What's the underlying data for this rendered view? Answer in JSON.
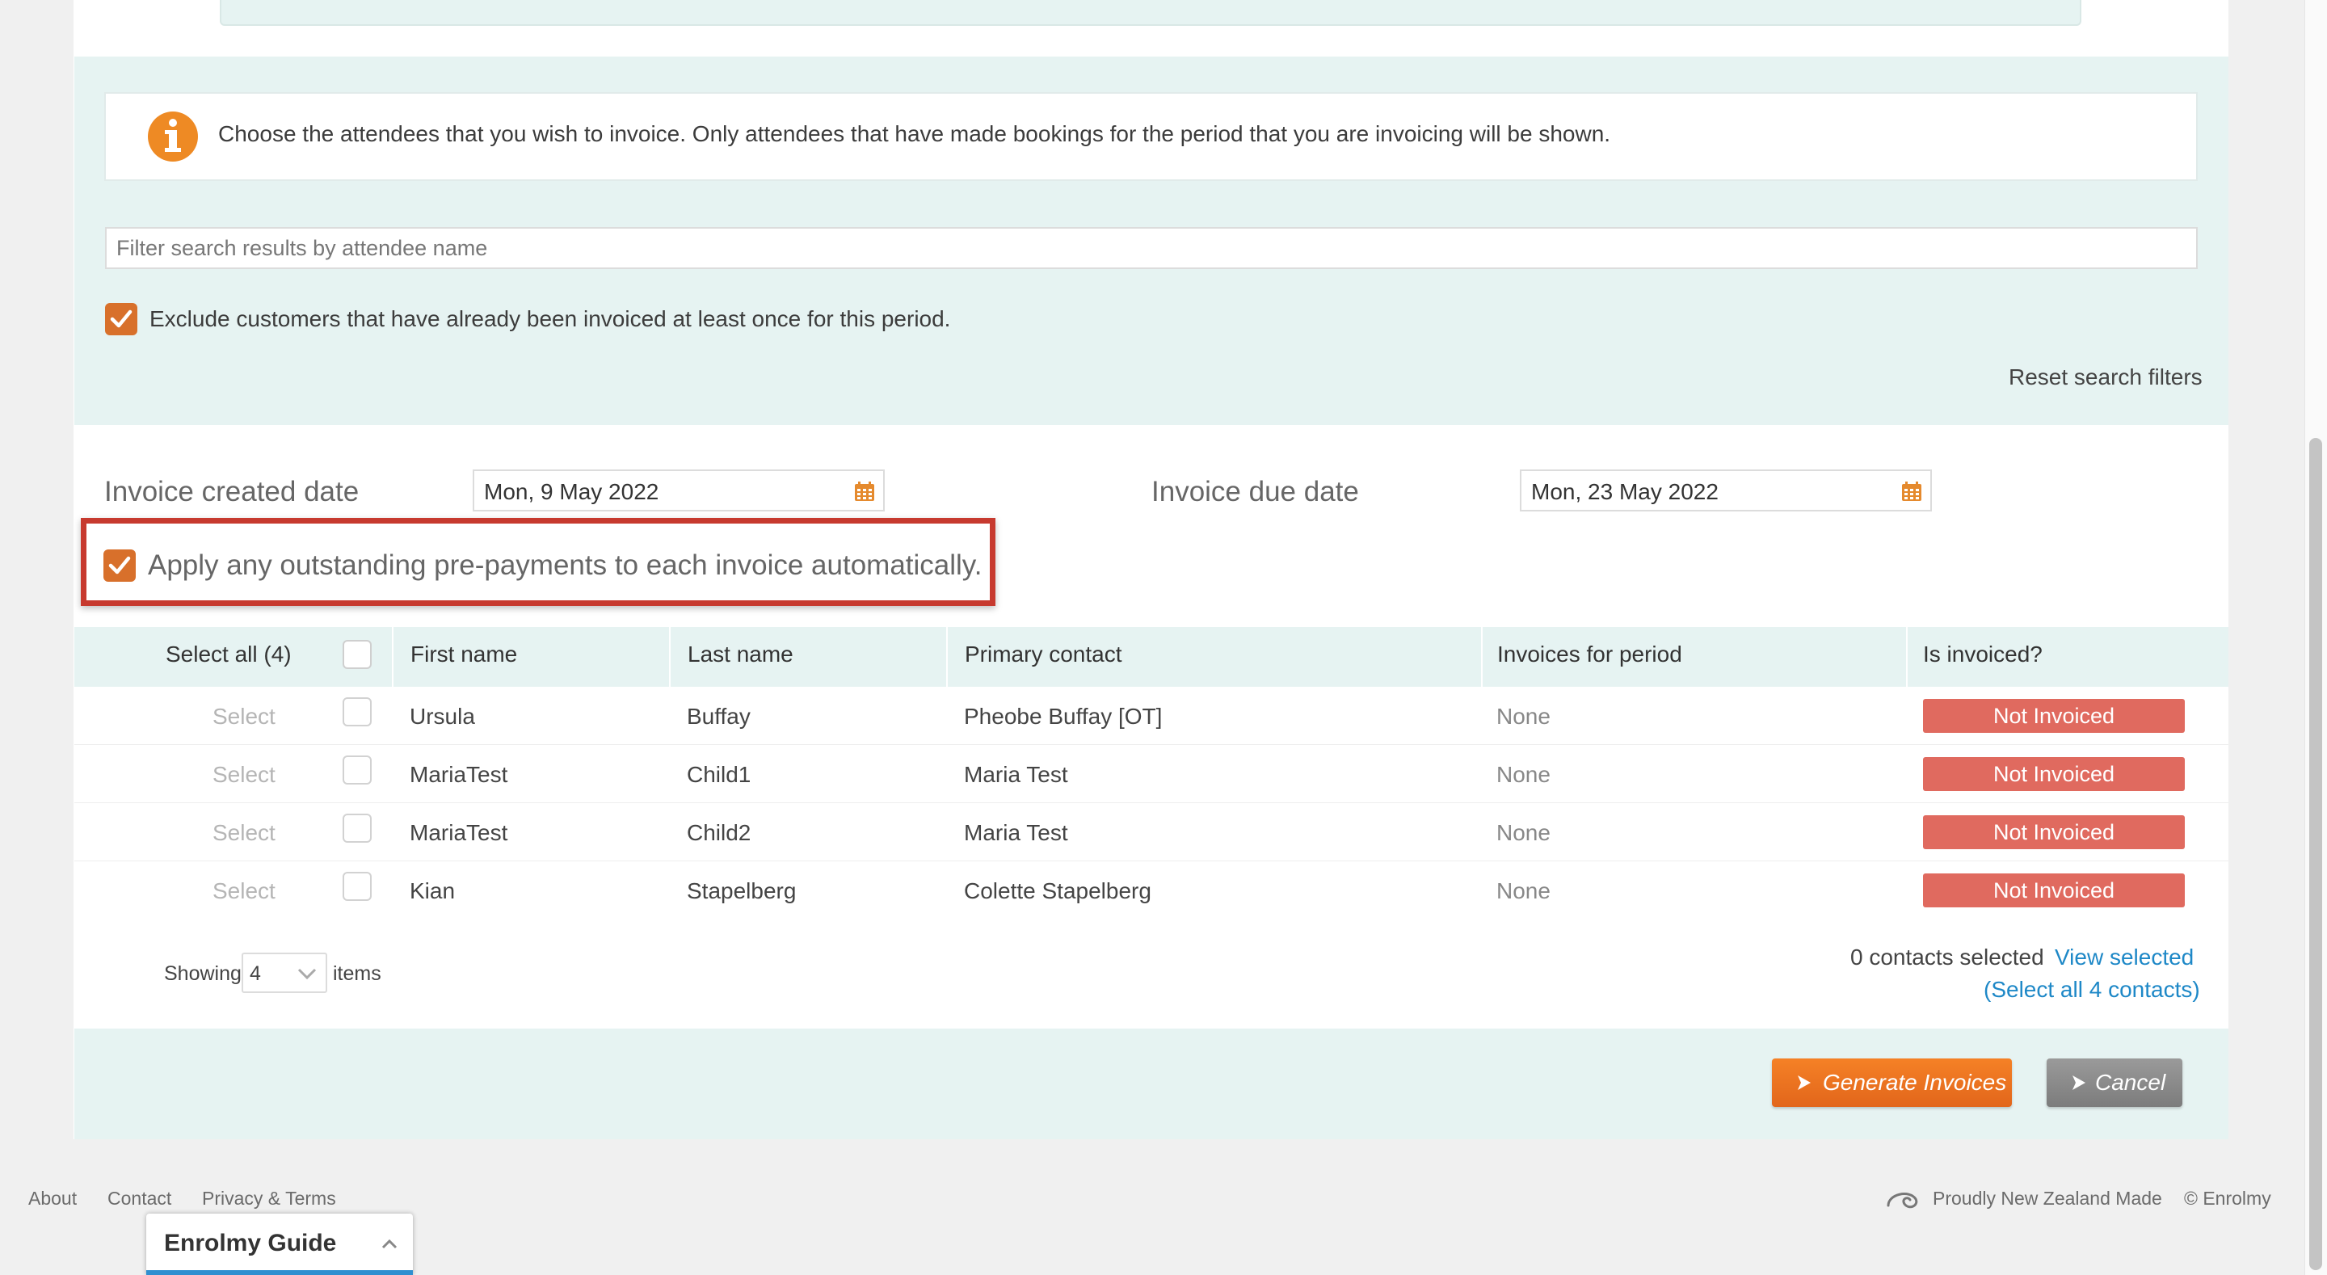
{
  "info": {
    "text": "Choose the attendees that you wish to invoice. Only attendees that have made bookings for the period that you are invoicing will be shown."
  },
  "filter": {
    "placeholder": "Filter search results by attendee name",
    "value": ""
  },
  "exclude": {
    "label": "Exclude customers that have already been invoiced at least once for this period.",
    "checked": true
  },
  "reset_label": "Reset search filters",
  "dates": {
    "created_label": "Invoice created date",
    "created_value": "Mon, 9 May 2022",
    "due_label": "Invoice due date",
    "due_value": "Mon, 23 May 2022"
  },
  "prepay": {
    "label": "Apply any outstanding pre-payments to each invoice automatically.",
    "checked": true
  },
  "table": {
    "headers": {
      "select_all": "Select all (4)",
      "first_name": "First name",
      "last_name": "Last name",
      "primary_contact": "Primary contact",
      "invoices_for_period": "Invoices for period",
      "is_invoiced": "Is invoiced?"
    },
    "rows": [
      {
        "select": "Select",
        "first": "Ursula",
        "last": "Buffay",
        "contact": "Pheobe Buffay [OT]",
        "invoices": "None",
        "status": "Not Invoiced"
      },
      {
        "select": "Select",
        "first": "MariaTest",
        "last": "Child1",
        "contact": "Maria Test",
        "invoices": "None",
        "status": "Not Invoiced"
      },
      {
        "select": "Select",
        "first": "MariaTest",
        "last": "Child2",
        "contact": "Maria Test",
        "invoices": "None",
        "status": "Not Invoiced"
      },
      {
        "select": "Select",
        "first": "Kian",
        "last": "Stapelberg",
        "contact": "Colette Stapelberg",
        "invoices": "None",
        "status": "Not Invoiced"
      }
    ]
  },
  "pager": {
    "showing": "Showing",
    "count": "4",
    "items": "items"
  },
  "selection": {
    "count_text": "0 contacts selected",
    "view_selected": "View selected",
    "select_all": "(Select all 4 contacts)"
  },
  "buttons": {
    "generate": "Generate Invoices",
    "cancel": "Cancel"
  },
  "footer": {
    "about": "About",
    "contact": "Contact",
    "privacy": "Privacy & Terms",
    "nz_made": "Proudly New Zealand Made",
    "copyright": "© Enrolmy"
  },
  "guide": {
    "title": "Enrolmy Guide"
  },
  "colors": {
    "accent": "#d8702b",
    "badge": "#e06a5f",
    "link": "#1e88c7",
    "highlight": "#c73a2f"
  }
}
